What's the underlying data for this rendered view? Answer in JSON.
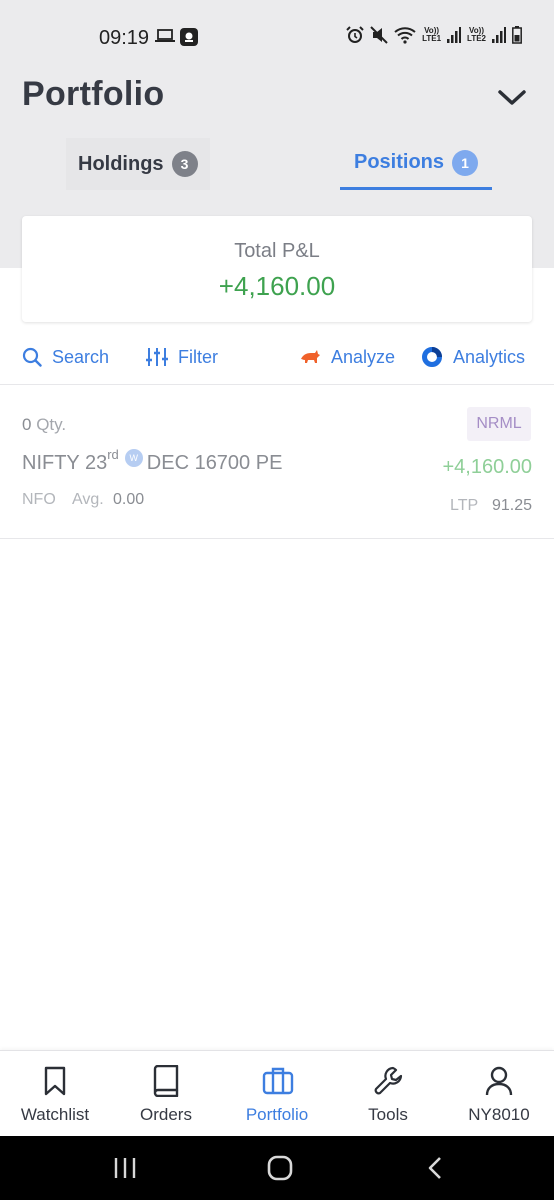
{
  "status_bar": {
    "time": "09:19",
    "sim1": "LTE1",
    "sim2": "LTE2",
    "volte1": "Vo))",
    "volte2": "Vo))"
  },
  "header": {
    "title": "Portfolio",
    "tabs": [
      {
        "label": "Holdings",
        "count": "3",
        "active": false
      },
      {
        "label": "Positions",
        "count": "1",
        "active": true
      }
    ]
  },
  "pnl_card": {
    "label": "Total P&L",
    "value": "+4,160.00"
  },
  "toolbar": {
    "search": "Search",
    "filter": "Filter",
    "analyze": "Analyze",
    "analytics": "Analytics"
  },
  "positions": [
    {
      "qty": "0",
      "qty_label": "Qty.",
      "product": "NRML",
      "symbol": "NIFTY 23",
      "expiry_suffix": "rd",
      "weekly_badge": "W",
      "contract": "DEC 16700 PE",
      "pnl": "+4,160.00",
      "exchange": "NFO",
      "avg_label": "Avg.",
      "avg_value": "0.00",
      "ltp_label": "LTP",
      "ltp_value": "91.25"
    }
  ],
  "bottom_nav": [
    {
      "label": "Watchlist",
      "icon": "bookmark-icon"
    },
    {
      "label": "Orders",
      "icon": "book-icon"
    },
    {
      "label": "Portfolio",
      "icon": "briefcase-icon",
      "active": true
    },
    {
      "label": "Tools",
      "icon": "wrench-icon"
    },
    {
      "label": "NY8010",
      "icon": "user-icon"
    }
  ],
  "colors": {
    "accent": "#3d7ee0",
    "profit": "#3ea24f",
    "header_bg": "#ebebed"
  }
}
